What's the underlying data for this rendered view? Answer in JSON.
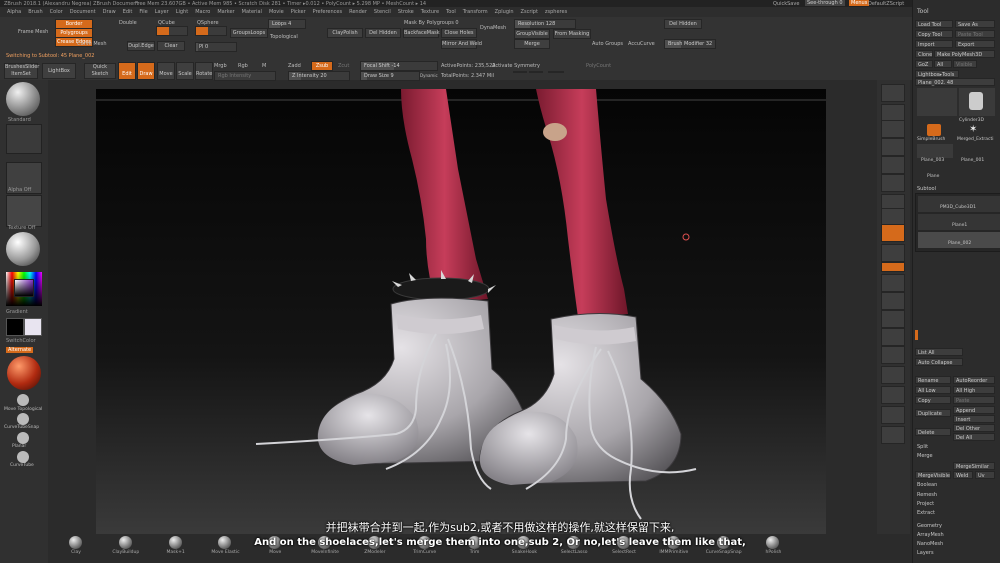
{
  "app": {
    "title": "ZBrush 2018.1 (Alexandru Negrea) ZBrush Document",
    "stats": "Free Mem 23.607GB • Active Mem 985 • Scratch Disk 281 • Timer ▸0.012 • PolyCount ▸ 5.298 MP • MeshCount ▸ 14",
    "quicksave": "QuickSave",
    "seethrough": "See-through 0",
    "menus_label": "Menus",
    "defaultscript": "DefaultZScript"
  },
  "menubar": [
    "Alpha",
    "Brush",
    "Color",
    "Document",
    "Draw",
    "Edit",
    "File",
    "Layer",
    "Light",
    "Macro",
    "Marker",
    "Material",
    "Movie",
    "Picker",
    "Preferences",
    "Render",
    "Stencil",
    "Stroke",
    "Texture",
    "Tool",
    "Transform",
    "Zplugin",
    "Zscript",
    "zspheres"
  ],
  "shelf": {
    "border": "Border",
    "polygroups": "Polygroups",
    "crease_edges": "Crease Edges",
    "frame_mesh": "Frame Mesh",
    "dupl_edge": "Dupl.Edge",
    "clear": "Clear",
    "curve_mesh": "Curve Mesh",
    "double": "Double",
    "qcube": "QCube",
    "qsphere": "QSphere",
    "loops": "Loops 4",
    "groups_loops": "GroupsLoops",
    "topological": "Topological",
    "polish_val": "Pl 0",
    "claypolish": "ClayPolish",
    "mask_by_polygroups": "Mask By Polygroups 0",
    "del_hidden": "Del Hidden",
    "backface_mask": "BackfaceMask",
    "close_holes": "Close Holes",
    "mirror_and_weld": "Mirror And Weld",
    "dynamesh": "DynaMesh",
    "resolution": "Resolution 128",
    "group_visible": "GroupVisible",
    "from_masking": "From Masking",
    "merge": "Merge",
    "auto_groups": "Auto Groups",
    "accucurve": "AccuCurve",
    "del_hidden2": "Del Hidden",
    "brush_modifier": "Brush Modifier 32"
  },
  "toolbar2": {
    "switching": "Switching to Subtool: 45  Plane_002",
    "brushes_item": "BrushesSlider ItemSet",
    "lightbox": "LightBox",
    "quick_sketch": "Quick Sketch",
    "edit": "Edit",
    "draw": "Draw",
    "move": "Move",
    "scale": "Scale",
    "rotate": "Rotate",
    "mrgb": "Mrgb",
    "rgb": "Rgb",
    "m": "M",
    "rgb_intensity": "Rgb Intensity",
    "zadd": "Zadd",
    "zsub": "Zsub",
    "zcut": "Zcut",
    "z_intensity": "Z Intensity 20",
    "focal_shift": "Focal Shift -14",
    "draw_size": "Draw Size 9",
    "dynamic": "Dynamic",
    "active_points": "ActivePoints: 235,522",
    "total_points": "TotalPoints: 2.347 Mil",
    "activate_symmetry": "Activate Symmetry",
    "poly_count": "PolyCount"
  },
  "lefttray": {
    "standard": "Standard",
    "alpha_off": "Alpha Off",
    "texture_off": "Texture Off",
    "gradient": "Gradient",
    "switch_color": "SwitchColor",
    "alternate": "Alternate",
    "move_topological": "Move Topological",
    "curve_tube": "CurveTubeSnap",
    "planar": "Planar",
    "curve_tube2": "CurveTube"
  },
  "bottom_brushes": [
    "Clay",
    "ClayBuildup",
    "Mask+1",
    "Move Elastic",
    "Move",
    "MoveInfinite",
    "ZModeler",
    "TrimCurve",
    "Trim",
    "SnakeHook",
    "SelectLasso",
    "SelectRect",
    "IMMPrimitive",
    "CurveSnapSnap",
    "hPolish"
  ],
  "right_panel": {
    "title": "Tool",
    "load_tool": "Load Tool",
    "save_as": "Save As",
    "copy_tool": "Copy Tool",
    "paste_tool": "Paste Tool",
    "import": "Import",
    "export": "Export",
    "clone": "Clone",
    "make_polymesh": "Make PolyMesh3D",
    "goz": "GoZ",
    "all": "All",
    "visible": "Visible",
    "lightbox_tools": "Lightbox▸Tools",
    "plane_name": "Plane_002. 48",
    "tool_items": [
      "Plane_002",
      "Cylinder3D",
      "SimpleBrush",
      "PolyMesh3D",
      "Merged_Extracti",
      "Plane_003",
      "Plane_001",
      "Plane"
    ],
    "subtool_header": "Subtool",
    "subtools": [
      "PM3D_Cube3D1",
      "Plane1",
      "Plane_002"
    ],
    "list_all": "List All",
    "auto_collapse": "Auto Collapse",
    "rename": "Rename",
    "auto_reorder": "AutoReorder",
    "all_low": "All Low",
    "all_high": "All High",
    "copy": "Copy",
    "paste": "Paste",
    "duplicate": "Duplicate",
    "append": "Append",
    "insert": "Insert",
    "delete": "Delete",
    "del_other": "Del Other",
    "del_all": "Del All",
    "split": "Split",
    "merge": "Merge",
    "merge_similar": "MergeSimilar",
    "merge_visible": "MergeVisible",
    "weld": "Weld",
    "uv": "Uv",
    "boolean": "Boolean",
    "remesh": "Remesh",
    "project": "Project",
    "extract": "Extract",
    "geometry": "Geometry",
    "arraymesh": "ArrayMesh",
    "nanomesh": "NanoMesh",
    "layers": "Layers"
  },
  "subtitles": {
    "zh": "并把袜带合并到一起,作为sub2,或者不用做这样的操作,就这样保留下来,",
    "en": "And on the shoelaces,let's merge them into one,sub 2, Or no,let's leave them like that,"
  },
  "colors": {
    "accent": "#d56a1b",
    "pants": "#b8344e",
    "shoe": "#b7b3b8"
  }
}
